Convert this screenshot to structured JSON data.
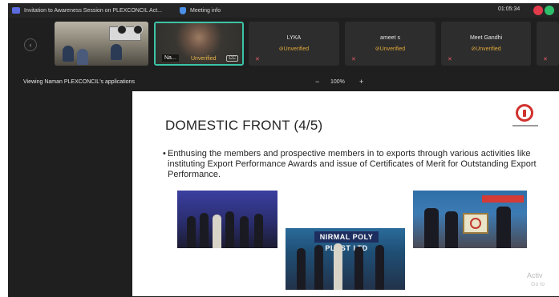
{
  "titlebar": {
    "title": "Invitation to Awareness Session on PLEXCONCIL Act...",
    "meeting_info": "Meeting info",
    "clock": "01:05:34"
  },
  "participants": {
    "tile2": {
      "name": "Na...",
      "status": "Unverified"
    },
    "tile3": {
      "name": "LYKA",
      "status": "Unverified"
    },
    "tile4": {
      "name": "ameet s",
      "status": "Unverified"
    },
    "tile5": {
      "name": "Meet Gandhi",
      "status": "Unverified"
    }
  },
  "share": {
    "viewing": "Viewing Naman PLEXCONCIL's applications",
    "zoom_minus": "−",
    "zoom_level": "100%",
    "zoom_plus": "+"
  },
  "slide": {
    "title": "DOMESTIC FRONT (4/5)",
    "bullet_mark": "•",
    "bullet": "Enthusing the members and prospective members in to exports through various activities like instituting Export Performance Awards and issue of Certificates of Merit for Outstanding Export Performance.",
    "photo_banner": "NIRMAL POLY PLAST LTD"
  },
  "os_watermark": {
    "line1": "Activ",
    "line2": "Go to"
  },
  "icons": {
    "app": "teams-icon",
    "meeting_info": "shield-icon",
    "prev": "chevron-left-icon",
    "mic_off": "mic-off-icon",
    "status": "unverified-icon"
  },
  "colors": {
    "window_bg": "#1f1f1f",
    "active_speaker": "#3bc4a8",
    "unverified": "#e0a83a",
    "record": "#e23b4b",
    "share": "#2fbf6b"
  }
}
